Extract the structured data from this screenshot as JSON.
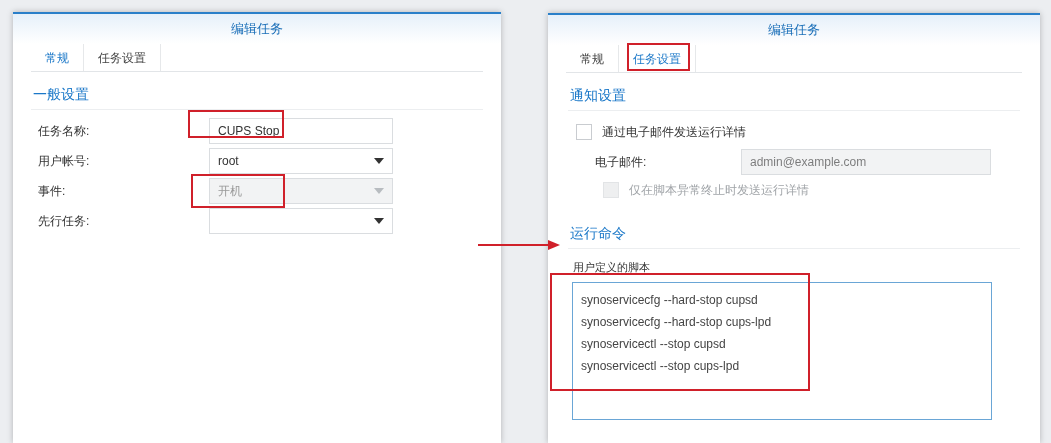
{
  "left_dialog": {
    "title": "编辑任务",
    "tabs": [
      {
        "label": "常规",
        "selected": true
      },
      {
        "label": "任务设置",
        "selected": false
      }
    ],
    "section": "一般设置",
    "fields": [
      {
        "label": "任务名称:",
        "kind": "text",
        "value": "CUPS Stop",
        "disabled": false
      },
      {
        "label": "用户帐号:",
        "kind": "select",
        "value": "root",
        "disabled": false
      },
      {
        "label": "事件:",
        "kind": "select",
        "value": "开机",
        "disabled": true
      },
      {
        "label": "先行任务:",
        "kind": "select",
        "disabled": false
      }
    ]
  },
  "right_dialog": {
    "title": "编辑任务",
    "tabs": [
      {
        "label": "常规",
        "selected": false
      },
      {
        "label": "任务设置",
        "selected": true
      }
    ],
    "notify_section": "通知设置",
    "email_checkbox": {
      "label": "通过电子邮件发送运行详情",
      "checked": false,
      "disabled": false
    },
    "email_field": {
      "label": "电子邮件:",
      "placeholder": "admin@example.com",
      "disabled": true
    },
    "abort_checkbox": {
      "label": "仅在脚本异常终止时发送运行详情",
      "checked": false,
      "disabled": true
    },
    "command_section": "运行命令",
    "script_label": "用户定义的脚本",
    "script_lines": [
      "synoservicecfg --hard-stop cupsd",
      "synoservicecfg --hard-stop cups-lpd",
      "synoservicectl --stop cupsd",
      "synoservicectl --stop cups-lpd"
    ]
  }
}
